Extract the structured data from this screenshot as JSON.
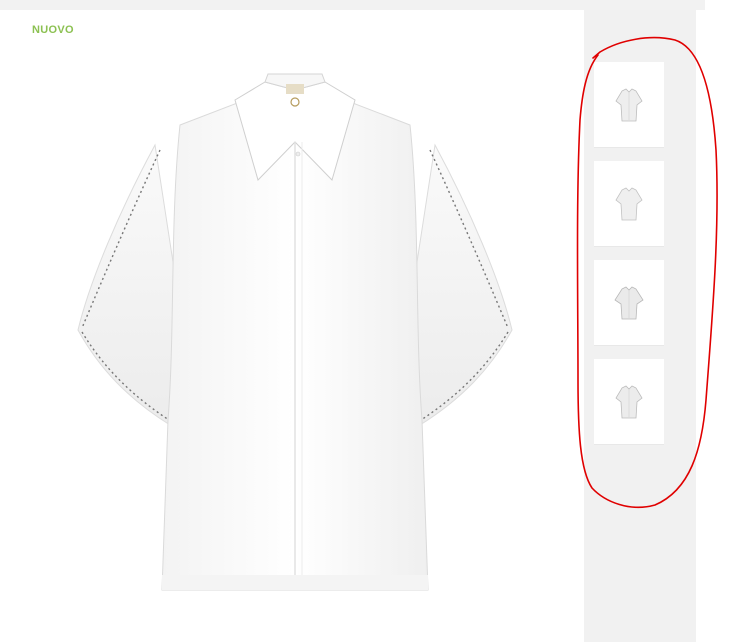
{
  "product": {
    "badge": "NUOVO",
    "main_image_icon": "white-flutter-sleeve-shirt",
    "thumbnails": [
      {
        "icon": "shirt-thumbnail-front"
      },
      {
        "icon": "shirt-thumbnail-back"
      },
      {
        "icon": "shirt-thumbnail-side"
      },
      {
        "icon": "shirt-thumbnail-detail"
      }
    ]
  },
  "colors": {
    "badge": "#8cc152",
    "annotation": "#e00000",
    "panel_background": "#f1f1f1"
  }
}
